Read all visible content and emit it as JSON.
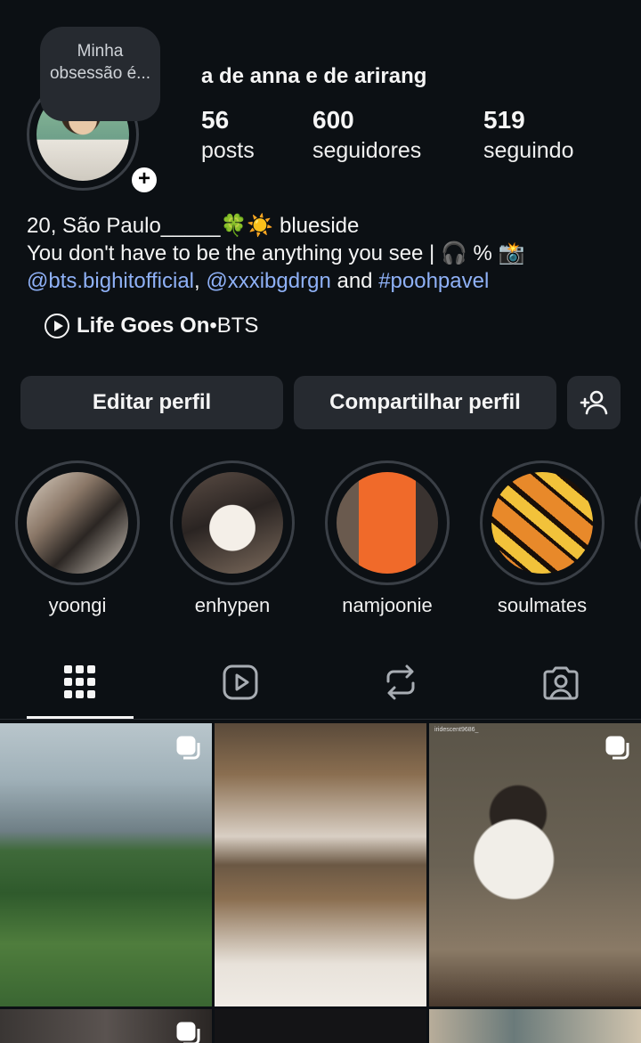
{
  "note": {
    "text": "Minha obsessão é..."
  },
  "profile": {
    "username": "a de anna e de arirang",
    "stats": [
      {
        "value": "56",
        "label": "posts"
      },
      {
        "value": "600",
        "label": "seguidores"
      },
      {
        "value": "519",
        "label": "seguindo"
      }
    ]
  },
  "bio": {
    "line1_text": "20, São Paulo_____",
    "line1_emoji": "🍀☀️",
    "line1_end": " blueside",
    "line2": "You don't have to be the anything you see | 🎧 % 📸",
    "mention1": "@bts.bighitofficial",
    "separator": ", ",
    "mention2": "@xxxibgdrgn",
    "and": " and ",
    "hashtag": "#poohpavel"
  },
  "music": {
    "song": "Life Goes On",
    "separator": " • ",
    "artist": "BTS"
  },
  "buttons": {
    "edit": "Editar perfil",
    "share": "Compartilhar perfil"
  },
  "highlights": [
    {
      "name": "yoongi"
    },
    {
      "name": "enhypen"
    },
    {
      "name": "namjoonie"
    },
    {
      "name": "soulmates"
    }
  ],
  "tabs": [
    "grid-icon",
    "reels-icon",
    "reposts-icon",
    "tagged-icon"
  ],
  "posts": [
    {
      "caption": ""
    },
    {
      "caption": ""
    },
    {
      "caption": "iridescent9686_"
    }
  ],
  "colors": {
    "background": "#0c1014",
    "button": "#262a30",
    "link": "#8fb1f7"
  }
}
